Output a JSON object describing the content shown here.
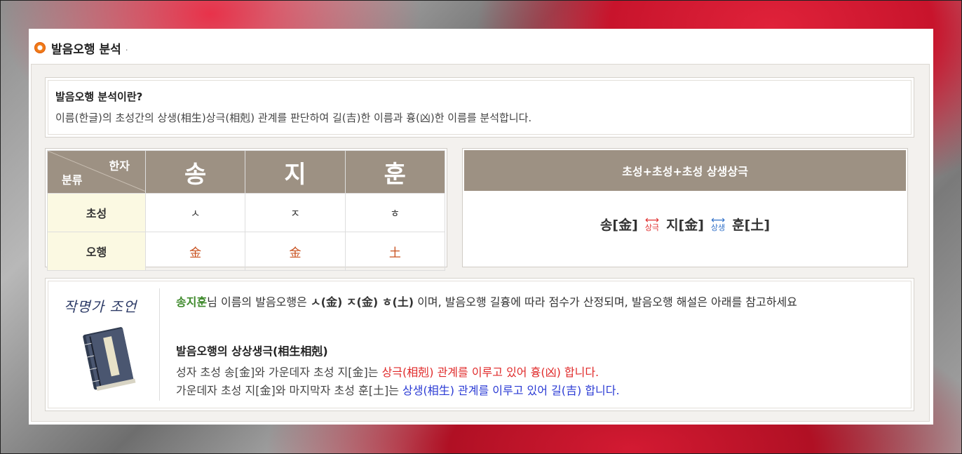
{
  "section": {
    "title": "발음오행 분석",
    "title_suffix": "."
  },
  "intro": {
    "heading": "발음오행 분석이란?",
    "text": "이름(한글)의 초성간의 상생(相生)상극(相剋) 관계를 판단하여 길(吉)한 이름과 흉(凶)한 이름를 분석합니다."
  },
  "hanja_table": {
    "corner_top": "한자",
    "corner_bottom": "분류",
    "chars": [
      "송",
      "지",
      "훈"
    ],
    "rows": [
      {
        "label": "초성",
        "values": [
          "ㅅ",
          "ㅈ",
          "ㅎ"
        ]
      },
      {
        "label": "오행",
        "values": [
          "金",
          "金",
          "土"
        ]
      }
    ]
  },
  "relation_box": {
    "header": "초성+초성+초성 상생상극",
    "first": "송[金]",
    "rel1": "상극",
    "second": "지[金]",
    "rel2": "상생",
    "third": "훈[土]"
  },
  "advice": {
    "caption": "작명가 조언",
    "name": "송지훈",
    "line1_a": "님 이름의 발음오행은 ",
    "line1_b": "ㅅ(金) ㅈ(金) ㅎ(土)",
    "line1_c": " 이며, 발음오행 길흉에 따라 점수가 산정되며, 발음오행 해설은 아래를 참고하세요",
    "heading": "발음오행의 상상생극(相生相剋)",
    "l2_a": "성자 초성 송[金]와 가운데자 초성 지[金]는 ",
    "l2_b": "상극(相剋) 관계를 이루고 있어 흉(凶) 합니다.",
    "l3_a": "가운데자 초성 지[金]와 마지막자 초성 훈[土]는 ",
    "l3_b": "상생(相生) 관계를 이루고 있어 길(吉) 합니다."
  },
  "colors": {
    "header_bg": "#9d9183",
    "row_label_bg": "#fbf9e2",
    "ohaeng_text": "#c8501e",
    "bad": "#e02a2a",
    "good": "#2a3ad4",
    "name_green": "#3f8a2c"
  }
}
